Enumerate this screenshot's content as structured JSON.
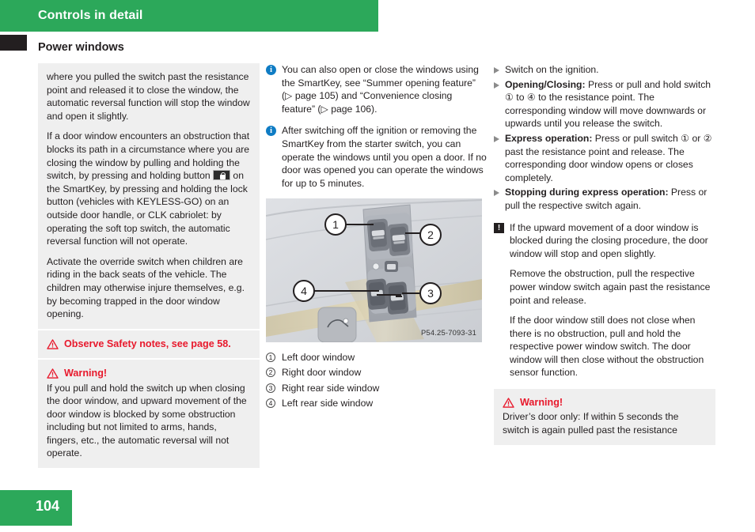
{
  "header": {
    "chapter_title": "Controls in detail",
    "section_title": "Power windows",
    "bar_color": "#2ca85a",
    "tab_color": "#231f20"
  },
  "column1": {
    "body_block": {
      "paragraphs": [
        "where you pulled the switch past the resistance point and released it to close the window, the automatic reversal function will stop the window and open it slightly.",
        "If a door window encounters an obstruction that blocks its path in a circumstance where you are closing the window by pulling and holding the switch, by pressing and holding button ",
        "Activate the override switch when children are riding in the back seats of the vehicle. The children may otherwise injure themselves, e.g. by becoming trapped in the door window opening."
      ],
      "para2_after_icon": " on the SmartKey, by pressing and holding the lock button (vehicles with KEYLESS-GO) on an outside door handle, or CLK cabriolet: by operating the soft top switch, the automatic reversal function will not operate.",
      "key_icon": "lock-button-icon"
    },
    "safety_note": {
      "icon": "warning-triangle-icon",
      "heading": "Observe Safety notes, see page 58.",
      "color": "#e8192c"
    },
    "warning": {
      "icon": "warning-triangle-icon",
      "heading": "Warning!",
      "body": "If you pull and hold the switch up when closing the door window, and upward movement of the door window is blocked by some obstruction including but not limited to arms, hands, fingers, etc., the automatic reversal will not operate.",
      "color": "#e8192c"
    }
  },
  "column2": {
    "notes": [
      {
        "icon": "info-circle-icon",
        "text": "You can also open or close the windows using the SmartKey, see “Summer opening feature” (▷ page 105) and “Convenience closing feature” (▷ page 106)."
      },
      {
        "icon": "info-circle-icon",
        "text": "After switching off the ignition or removing the SmartKey from the starter switch, you can operate the windows until you open a door. If no door was opened you can operate the windows for up to 5 minutes."
      }
    ],
    "figure": {
      "name": "power-window-switch-panel-illustration",
      "code": "P54.25-7093-31",
      "callouts": [
        "1",
        "2",
        "3",
        "4"
      ]
    },
    "caption_items": [
      {
        "num": "1",
        "label": "Left door window"
      },
      {
        "num": "2",
        "label": "Right door window"
      },
      {
        "num": "3",
        "label": "Right rear side window"
      },
      {
        "num": "4",
        "label": "Left rear side window"
      }
    ]
  },
  "column3": {
    "bullets": [
      {
        "bold": "",
        "text": "Switch on the ignition."
      },
      {
        "bold": "Opening/Closing:",
        "text": " Press or pull and hold switch ① to ④ to the resistance point. The corresponding window will move downwards or upwards until you release the switch.",
        "nums": [
          "1",
          "4"
        ]
      },
      {
        "bold": "Express operation:",
        "text": " Press or pull switch ① or ② past the resistance point and release. The corresponding door window opens or closes completely.",
        "nums": [
          "1",
          "2"
        ]
      },
      {
        "bold": "Stopping during express operation:",
        "text": " Press or pull the respective switch again."
      }
    ],
    "caution": {
      "icon": "caution-exclamation-icon",
      "paragraphs": [
        "If the upward movement of a door window is blocked during the closing procedure, the door window will stop and open slightly.",
        "Remove the obstruction, pull the respective power window switch again past the resistance point and release.",
        "If the door window still does not close when there is no obstruction, pull and hold the respective power window switch. The door window will then close without the obstruction sensor function."
      ]
    },
    "warning": {
      "icon": "warning-triangle-icon",
      "heading": "Warning!",
      "body": "Driver’s door only: If within 5 seconds the switch is again pulled past the resistance",
      "color": "#e8192c"
    }
  },
  "footer": {
    "page_number": "104",
    "bar_color": "#2ca85a"
  }
}
